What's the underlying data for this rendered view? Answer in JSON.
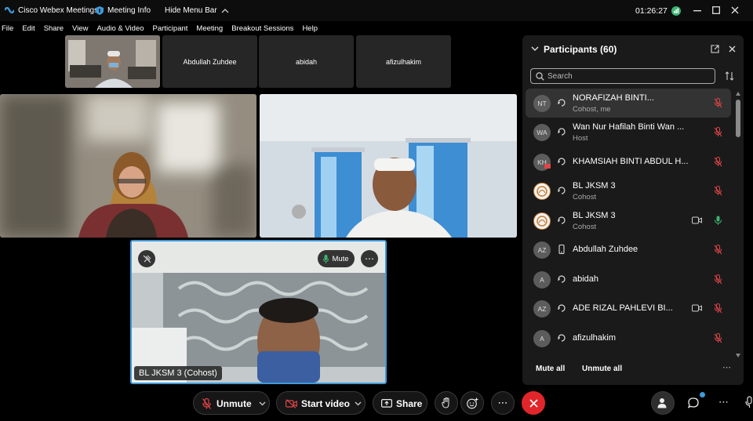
{
  "titlebar": {
    "app_name": "Cisco Webex Meetings",
    "meeting_info": "Meeting Info",
    "hide_menu_bar": "Hide Menu Bar",
    "timer": "01:26:27"
  },
  "menubar": {
    "items": [
      "File",
      "Edit",
      "Share",
      "View",
      "Audio & Video",
      "Participant",
      "Meeting",
      "Breakout Sessions",
      "Help"
    ]
  },
  "thumbnails": [
    {
      "name": ""
    },
    {
      "name": "Abdullah Zuhdee"
    },
    {
      "name": "abidah"
    },
    {
      "name": "afizulhakim"
    }
  ],
  "active_speaker": {
    "label": "BL JKSM 3 (Cohost)",
    "mute_label": "Mute"
  },
  "controls": {
    "unmute_label": "Unmute",
    "start_video_label": "Start video",
    "share_label": "Share"
  },
  "participants_panel": {
    "title": "Participants (60)",
    "search_placeholder": "Search",
    "mute_all_label": "Mute all",
    "unmute_all_label": "Unmute all",
    "participants": [
      {
        "initials": "NT",
        "name": "NORAFIZAH BINTI...",
        "role": "Cohost, me",
        "selected": true,
        "mic": "muted",
        "camera": false
      },
      {
        "initials": "WA",
        "name": "Wan Nur Hafilah Binti Wan ...",
        "role": "Host",
        "selected": false,
        "mic": "muted",
        "camera": false
      },
      {
        "initials": "KH",
        "name": "KHAMSIAH BINTI ABDUL H...",
        "role": "",
        "selected": false,
        "mic": "muted",
        "camera": false
      },
      {
        "initials": "",
        "name": "BL JKSM 3",
        "role": "Cohost",
        "selected": false,
        "mic": "muted",
        "camera": false
      },
      {
        "initials": "",
        "name": "BL JKSM 3",
        "role": "Cohost",
        "selected": false,
        "mic": "active",
        "camera": true
      },
      {
        "initials": "AZ",
        "name": "Abdullah Zuhdee",
        "role": "",
        "selected": false,
        "mic": "muted",
        "camera": false
      },
      {
        "initials": "A",
        "name": "abidah",
        "role": "",
        "selected": false,
        "mic": "muted",
        "camera": false
      },
      {
        "initials": "AZ",
        "name": "ADE RIZAL PAHLEVI BI...",
        "role": "",
        "selected": false,
        "mic": "muted",
        "camera": true
      },
      {
        "initials": "A",
        "name": "afizulhakim",
        "role": "",
        "selected": false,
        "mic": "muted",
        "camera": false
      }
    ]
  },
  "colors": {
    "accent_blue": "#3f9ad8",
    "end_red": "#e0262b",
    "muted_red": "#e0454a",
    "active_green": "#3cb371",
    "panel_bg": "#1a1a1a"
  }
}
